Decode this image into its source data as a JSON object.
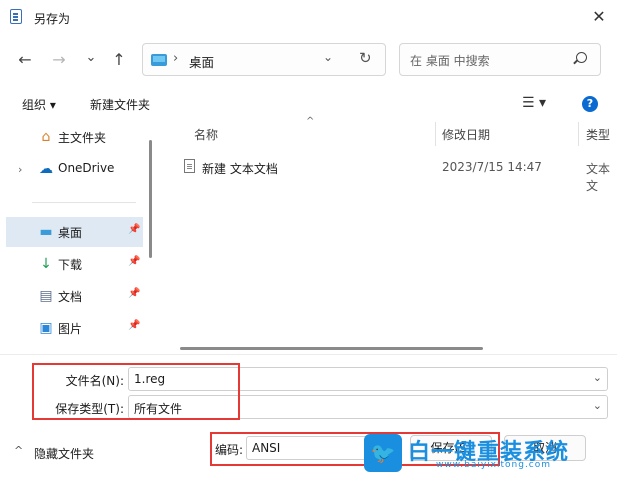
{
  "window": {
    "title": "另存为",
    "close_glyph": "✕"
  },
  "nav": {
    "back": "←",
    "forward": "→",
    "recent": "⌄",
    "up": "↑"
  },
  "address": {
    "separator": "›",
    "location": "桌面",
    "dropdown": "⌄",
    "refresh": "↻"
  },
  "search": {
    "placeholder": "在 桌面 中搜索"
  },
  "toolbar": {
    "organize": "组织 ▾",
    "new_folder": "新建文件夹",
    "view": "☰ ▾",
    "help": "?"
  },
  "sidebar": {
    "items": [
      {
        "label": "主文件夹",
        "icon": "⌂",
        "icon_color": "#d9822b",
        "pinned": false
      },
      {
        "label": "OneDrive",
        "icon": "☁",
        "icon_color": "#0f6cbd",
        "pinned": false
      },
      {
        "label": "桌面",
        "icon": "▬",
        "icon_color": "#3a9bd9",
        "pinned": true
      },
      {
        "label": "下载",
        "icon": "↓",
        "icon_color": "#1f9d55",
        "pinned": true
      },
      {
        "label": "文档",
        "icon": "▤",
        "icon_color": "#5a6f8a",
        "pinned": true
      },
      {
        "label": "图片",
        "icon": "▣",
        "icon_color": "#2b88d8",
        "pinned": true
      }
    ],
    "expand_glyph": "›",
    "pin_glyph": "📌"
  },
  "files": {
    "columns": {
      "name": "名称",
      "modified": "修改日期",
      "type": "类型"
    },
    "sort_arrow": "^",
    "rows": [
      {
        "name": "新建 文本文档",
        "modified": "2023/7/15 14:47",
        "type": "文本文"
      }
    ]
  },
  "form": {
    "filename_label": "文件名(N):",
    "filename_value": "1.reg",
    "filetype_label": "保存类型(T):",
    "filetype_value": "所有文件",
    "encoding_label": "编码:",
    "encoding_value": "ANSI",
    "dropdown_glyph": "⌄"
  },
  "footer": {
    "hide_folders": "隐藏文件夹",
    "hide_chevron": "^",
    "save": "保存(S)",
    "cancel": "取消"
  },
  "watermark": {
    "brand": "白一键重装系统",
    "url": "www.baiyixitong.com",
    "bird": "🐦"
  },
  "colors": {
    "accent": "#0b6ad1",
    "highlight": "#e53935",
    "selected_bg": "#dfe9f4"
  }
}
